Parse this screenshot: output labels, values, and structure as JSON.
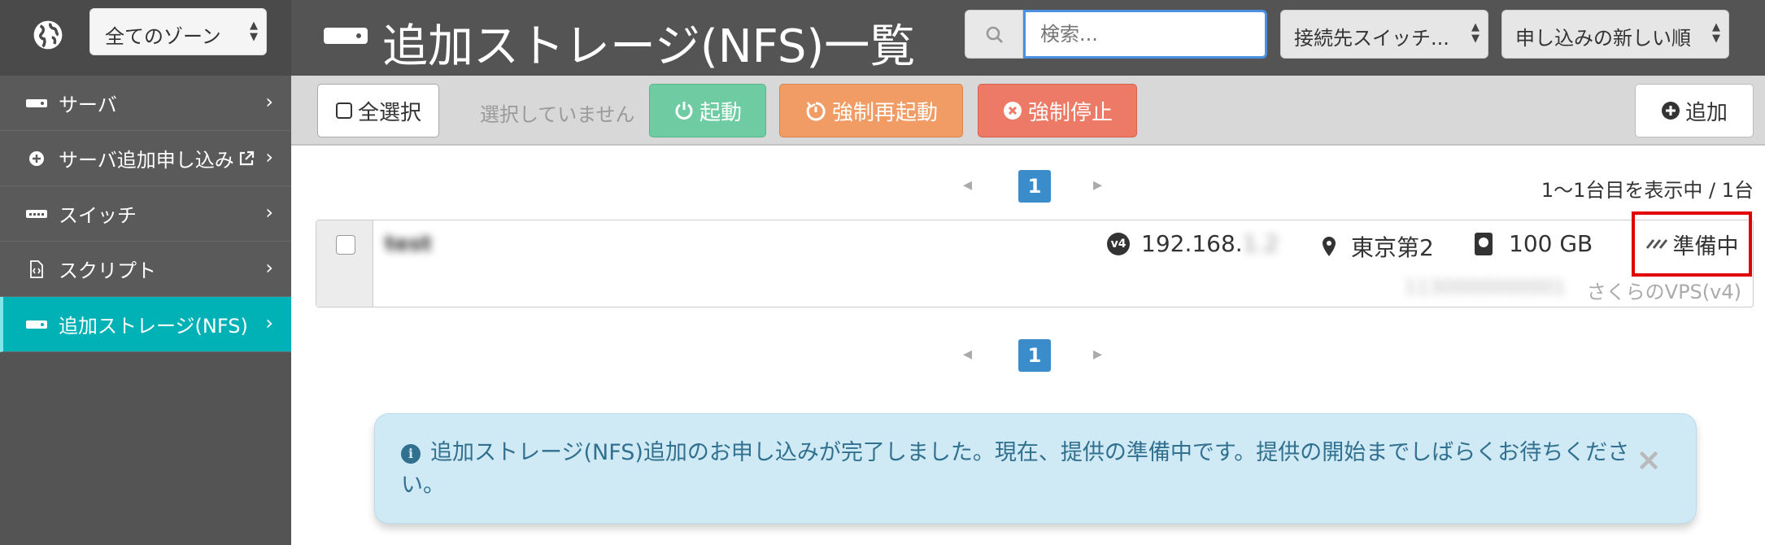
{
  "sidebar": {
    "zone_select": "全てのゾーン",
    "items": [
      {
        "label": "サーバ",
        "icon": "server-icon",
        "external": false,
        "active": false
      },
      {
        "label": "サーバ追加申し込み",
        "icon": "plus-circle-icon",
        "external": true,
        "active": false
      },
      {
        "label": "スイッチ",
        "icon": "switch-icon",
        "external": false,
        "active": false
      },
      {
        "label": "スクリプト",
        "icon": "script-file-icon",
        "external": false,
        "active": false
      },
      {
        "label": "追加ストレージ(NFS)",
        "icon": "storage-icon",
        "external": false,
        "active": true
      }
    ]
  },
  "header": {
    "title": "追加ストレージ(NFS)一覧",
    "search": {
      "placeholder": "検索..."
    },
    "switch_filter": "接続先スイッチ...",
    "sort": "申し込みの新しい順"
  },
  "toolbar": {
    "select_all": "全選択",
    "selection_status": "選択していません",
    "start": "起動",
    "force_restart": "強制再起動",
    "force_stop": "強制停止",
    "add": "追加"
  },
  "pagination": {
    "current_page": "1",
    "count_text": "1〜1台目を表示中 / 1台"
  },
  "item": {
    "name": "test",
    "ip_version": "v4",
    "ip_prefix": "192.168.",
    "ip_suffix": "1.2",
    "zone": "東京第2",
    "size": "100 GB",
    "status": "準備中",
    "id_blurred": "1130000000001",
    "plan": "さくらのVPS(v4)"
  },
  "alert": {
    "message": "追加ストレージ(NFS)追加のお申し込みが完了しました。現在、提供の準備中です。提供の開始までしばらくお待ちください。",
    "close": "×"
  },
  "colors": {
    "sidebar_bg": "#545454",
    "active_nav": "#00b1b5",
    "start_button": "#6fcca2",
    "restart_button": "#f19c64",
    "stop_button": "#ec7a66",
    "page_button": "#3a8ccb",
    "alert_bg": "#cfe9f5",
    "highlight_border": "#e00000"
  }
}
